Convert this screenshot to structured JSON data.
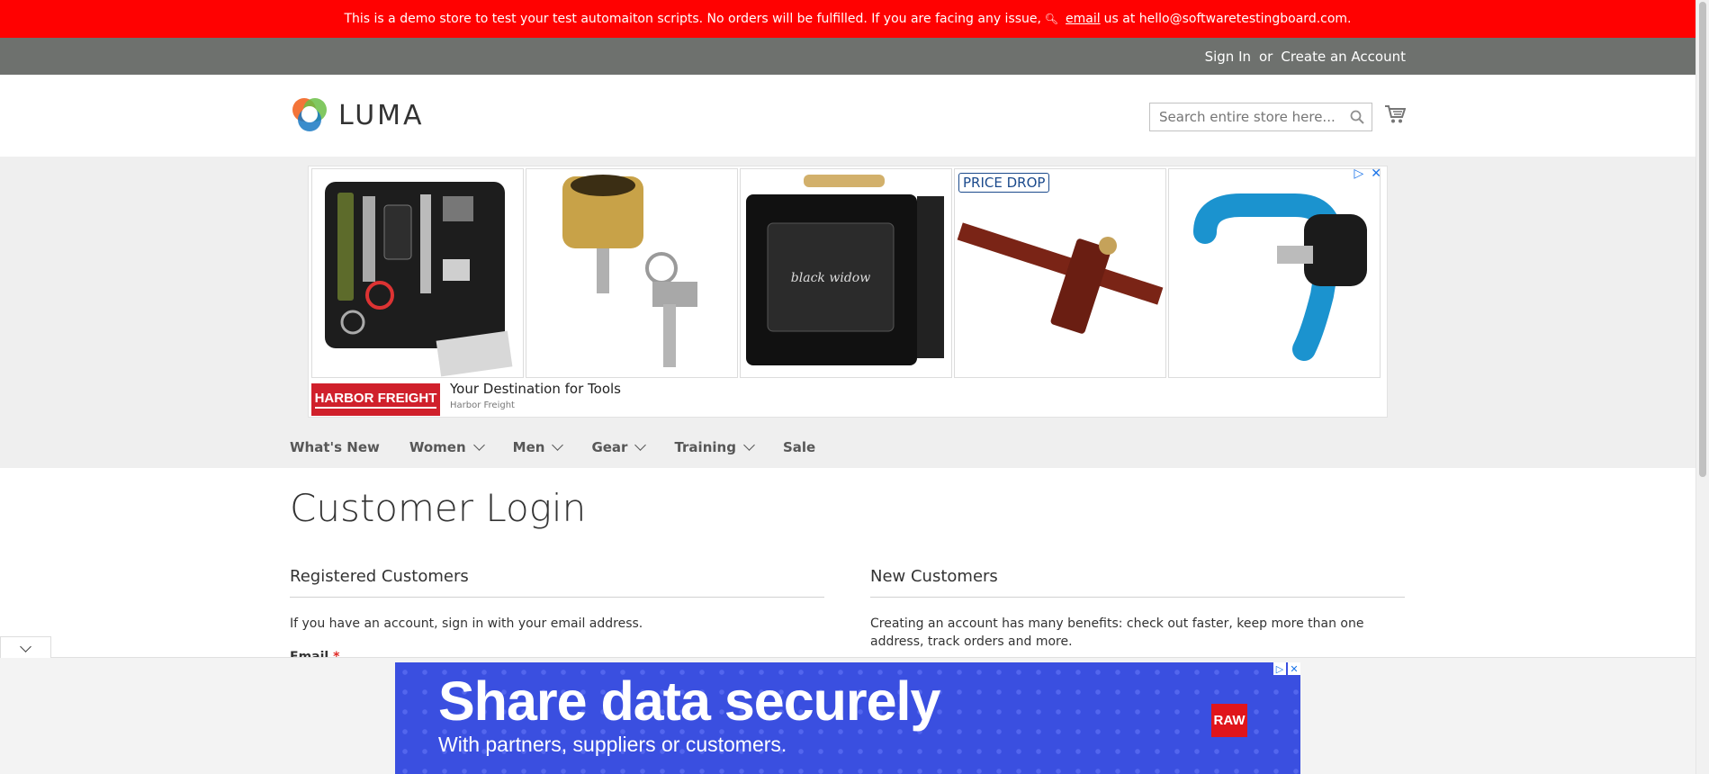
{
  "demo_notice": {
    "text_before": "This is a demo store to test your test automaiton scripts. No orders will be fulfilled. If you are facing any issue,",
    "email_link": "email",
    "text_after": "us at hello@softwaretestingboard.com."
  },
  "panel": {
    "sign_in": "Sign In",
    "or": "or",
    "create_account": "Create an Account"
  },
  "header": {
    "logo_text": "LUMA",
    "search_placeholder": "Search entire store here..."
  },
  "ad": {
    "price_badge": "PRICE DROP",
    "advertiser_logo": "HARBOR FREIGHT",
    "headline": "Your Destination for Tools",
    "advertiser": "Harbor Freight"
  },
  "nav": {
    "items": [
      {
        "label": "What's New"
      },
      {
        "label": "Women"
      },
      {
        "label": "Men"
      },
      {
        "label": "Gear"
      },
      {
        "label": "Training"
      },
      {
        "label": "Sale"
      }
    ]
  },
  "page": {
    "title": "Customer Login",
    "registered": {
      "title": "Registered Customers",
      "text": "If you have an account, sign in with your email address.",
      "email_label": "Email",
      "required_mark": "*"
    },
    "new_customers": {
      "title": "New Customers",
      "text": "Creating an account has many benefits: check out faster, keep more than one address, track orders and more."
    }
  },
  "bottom_ad": {
    "headline": "Share data securely",
    "subline": "With partners, suppliers or customers.",
    "logo": "RAW"
  },
  "colors": {
    "demo_bar": "#ff0101",
    "panel": "#6e716e",
    "ad_blue": "#3a4fe0"
  }
}
